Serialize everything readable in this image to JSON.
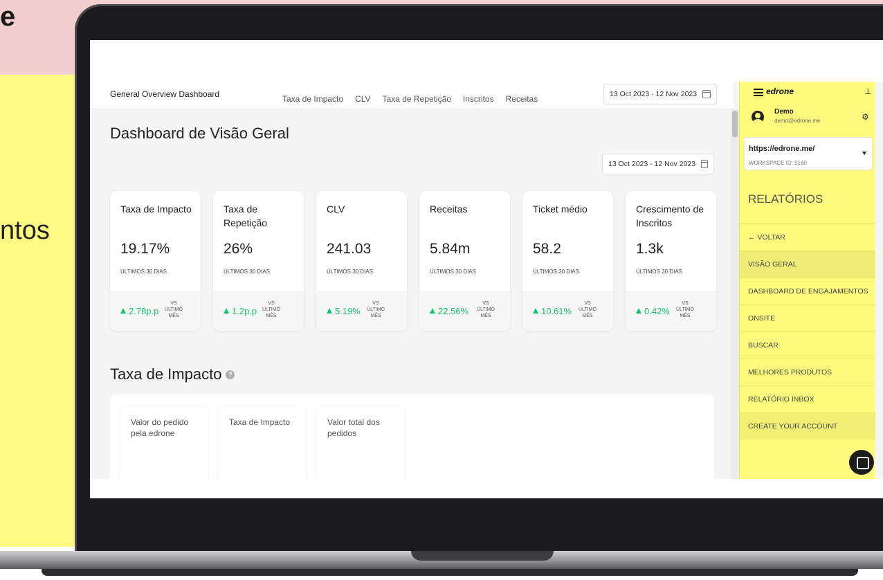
{
  "backdrop": {
    "top_fragment": "e",
    "mid_fragment": "ntos"
  },
  "topbar": {
    "breadcrumb": "General Overview Dashboard",
    "tabs": [
      "Taxa de Impacto",
      "CLV",
      "Taxa de Repetição",
      "Inscritos",
      "Receitas"
    ],
    "date_range": "13 Oct 2023 - 12 Nov 2023"
  },
  "main": {
    "title": "Dashboard de Visão Geral",
    "date_range": "13 Oct 2023 - 12 Nov 2023",
    "cards": [
      {
        "title": "Taxa de Impacto",
        "value": "19.17%",
        "period": "ÚLTIMOS 30 DIAS",
        "delta": "2.78p.p",
        "vs": "VS ÚLTIMO MÊS"
      },
      {
        "title": "Taxa de Repetição",
        "value": "26%",
        "period": "ÚLTIMOS 30 DIAS",
        "delta": "1.2p.p",
        "vs": "VS ÚLTIMO MÊS"
      },
      {
        "title": "CLV",
        "value": "241.03",
        "period": "ÚLTIMOS 30 DIAS",
        "delta": "5.19%",
        "vs": "VS ÚLTIMO MÊS"
      },
      {
        "title": "Receitas",
        "value": "5.84m",
        "period": "ÚLTIMOS 30 DIAS",
        "delta": "22.56%",
        "vs": "VS ÚLTIMO MÊS"
      },
      {
        "title": "Ticket médio",
        "value": "58.2",
        "period": "ÚLTIMOS 30 DIAS",
        "delta": "10.61%",
        "vs": "VS ÚLTIMO MÊS"
      },
      {
        "title": "Crescimento de Inscritos",
        "value": "1.3k",
        "period": "ÚLTIMOS 30 DIAS",
        "delta": "0.42%",
        "vs": "VS ÚLTIMO MÊS"
      }
    ],
    "section_title": "Taxa de Impacto",
    "mini_cards": [
      "Valor do pedido pela edrone",
      "Taxa de Impacto",
      "Valor total dos pedidos"
    ]
  },
  "sidebar": {
    "logo": "edrone",
    "user_name": "Demo",
    "user_email": "demo@edrone.me",
    "workspace_url": "https://edrone.me/",
    "workspace_id": "WORKSPACE ID: 5160",
    "section": "RELATÓRIOS",
    "items": [
      "← VOLTAR",
      "VISÃO GERAL",
      "DASHBOARD DE ENGAJAMENTOS",
      "ONSITE",
      "BUSCAR",
      "MELHORES PRODUTOS",
      "RELATÓRIO INBOX",
      "CREATE YOUR ACCOUNT"
    ]
  },
  "colors": {
    "accent_yellow": "#fdfa7e",
    "positive_green": "#18c26b",
    "backdrop_pink": "#f4cfcf"
  }
}
